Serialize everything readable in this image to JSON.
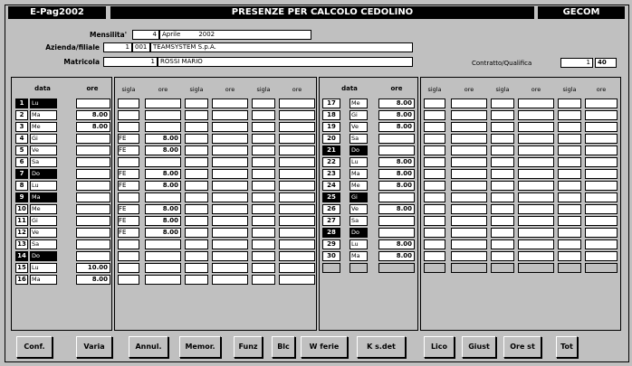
{
  "header": {
    "left_title": "E-Pag2002",
    "title": "PRESENZE PER CALCOLO CEDOLINO",
    "right_title": "GECOM"
  },
  "form": {
    "mensilita_label": "Mensilita'",
    "mensilita_num": "4",
    "mensilita_month": "Aprile",
    "mensilita_year": "2002",
    "azienda_label": "Azienda/filiale",
    "azienda_code": "1",
    "azienda_filiale": "001",
    "azienda_name": "TEAMSYSTEM S.p.A.",
    "matricola_label": "Matricola",
    "matricola_value": "1",
    "matricola_name": "ROSSI MARIO",
    "contratto_label": "Contratto/Qualifica",
    "contratto_code": "1",
    "contratto_qual": "40"
  },
  "table_headers": {
    "data": "data",
    "ore": "ore",
    "sigla": "sigla",
    "ore_small": "ore"
  },
  "days_left": [
    {
      "n": "1",
      "d": "Lu",
      "ore": "",
      "s1": "",
      "o1": "",
      "dark": true
    },
    {
      "n": "2",
      "d": "Ma",
      "ore": "8.00",
      "s1": "",
      "o1": "",
      "dark": false
    },
    {
      "n": "3",
      "d": "Me",
      "ore": "8.00",
      "s1": "",
      "o1": "",
      "dark": false
    },
    {
      "n": "4",
      "d": "Gi",
      "ore": "",
      "s1": "FE",
      "o1": "8.00",
      "dark": false
    },
    {
      "n": "5",
      "d": "Ve",
      "ore": "",
      "s1": "FE",
      "o1": "8.00",
      "dark": false
    },
    {
      "n": "6",
      "d": "Sa",
      "ore": "",
      "s1": "",
      "o1": "",
      "dark": false
    },
    {
      "n": "7",
      "d": "Do",
      "ore": "",
      "s1": "FE",
      "o1": "8.00",
      "dark": true
    },
    {
      "n": "8",
      "d": "Lu",
      "ore": "",
      "s1": "FE",
      "o1": "8.00",
      "dark": false
    },
    {
      "n": "9",
      "d": "Ma",
      "ore": "",
      "s1": "",
      "o1": "",
      "dark": true
    },
    {
      "n": "10",
      "d": "Me",
      "ore": "",
      "s1": "FE",
      "o1": "8.00",
      "dark": false
    },
    {
      "n": "11",
      "d": "Gi",
      "ore": "",
      "s1": "FE",
      "o1": "8.00",
      "dark": false
    },
    {
      "n": "12",
      "d": "Ve",
      "ore": "",
      "s1": "FE",
      "o1": "8.00",
      "dark": false
    },
    {
      "n": "13",
      "d": "Sa",
      "ore": "",
      "s1": "",
      "o1": "",
      "dark": false
    },
    {
      "n": "14",
      "d": "Do",
      "ore": "",
      "s1": "",
      "o1": "",
      "dark": true
    },
    {
      "n": "15",
      "d": "Lu",
      "ore": "10.00",
      "s1": "",
      "o1": "",
      "dark": false
    },
    {
      "n": "16",
      "d": "Ma",
      "ore": "8.00",
      "s1": "",
      "o1": "",
      "dark": false
    }
  ],
  "days_right": [
    {
      "n": "17",
      "d": "Me",
      "ore": "8.00",
      "dark": false
    },
    {
      "n": "18",
      "d": "Gi",
      "ore": "8.00",
      "dark": false
    },
    {
      "n": "19",
      "d": "Ve",
      "ore": "8.00",
      "dark": false
    },
    {
      "n": "20",
      "d": "Sa",
      "ore": "",
      "dark": false
    },
    {
      "n": "21",
      "d": "Do",
      "ore": "",
      "dark": true
    },
    {
      "n": "22",
      "d": "Lu",
      "ore": "8.00",
      "dark": false
    },
    {
      "n": "23",
      "d": "Ma",
      "ore": "8.00",
      "dark": false
    },
    {
      "n": "24",
      "d": "Me",
      "ore": "8.00",
      "dark": false
    },
    {
      "n": "25",
      "d": "Gi",
      "ore": "",
      "dark": true
    },
    {
      "n": "26",
      "d": "Ve",
      "ore": "8.00",
      "dark": false
    },
    {
      "n": "27",
      "d": "Sa",
      "ore": "",
      "dark": false
    },
    {
      "n": "28",
      "d": "Do",
      "ore": "",
      "dark": true
    },
    {
      "n": "29",
      "d": "Lu",
      "ore": "8.00",
      "dark": false
    },
    {
      "n": "30",
      "d": "Ma",
      "ore": "8.00",
      "dark": false
    }
  ],
  "buttons": [
    {
      "label": "Conf.",
      "name": "conf-button"
    },
    {
      "label": "Varia",
      "name": "varia-button"
    },
    {
      "label": "Annul.",
      "name": "annul-button"
    },
    {
      "label": "Memor.",
      "name": "memor-button"
    },
    {
      "label": "Funz",
      "name": "funz-button"
    },
    {
      "label": "Blc",
      "name": "blc-button"
    },
    {
      "label": "W ferie",
      "name": "ferie-button"
    },
    {
      "label": "K s.det",
      "name": "ksdet-button"
    },
    {
      "label": "Lico",
      "name": "lico-button"
    },
    {
      "label": "Giust",
      "name": "giust-button"
    },
    {
      "label": "Ore st",
      "name": "orest-button"
    },
    {
      "label": "Tot",
      "name": "tot-button"
    }
  ]
}
